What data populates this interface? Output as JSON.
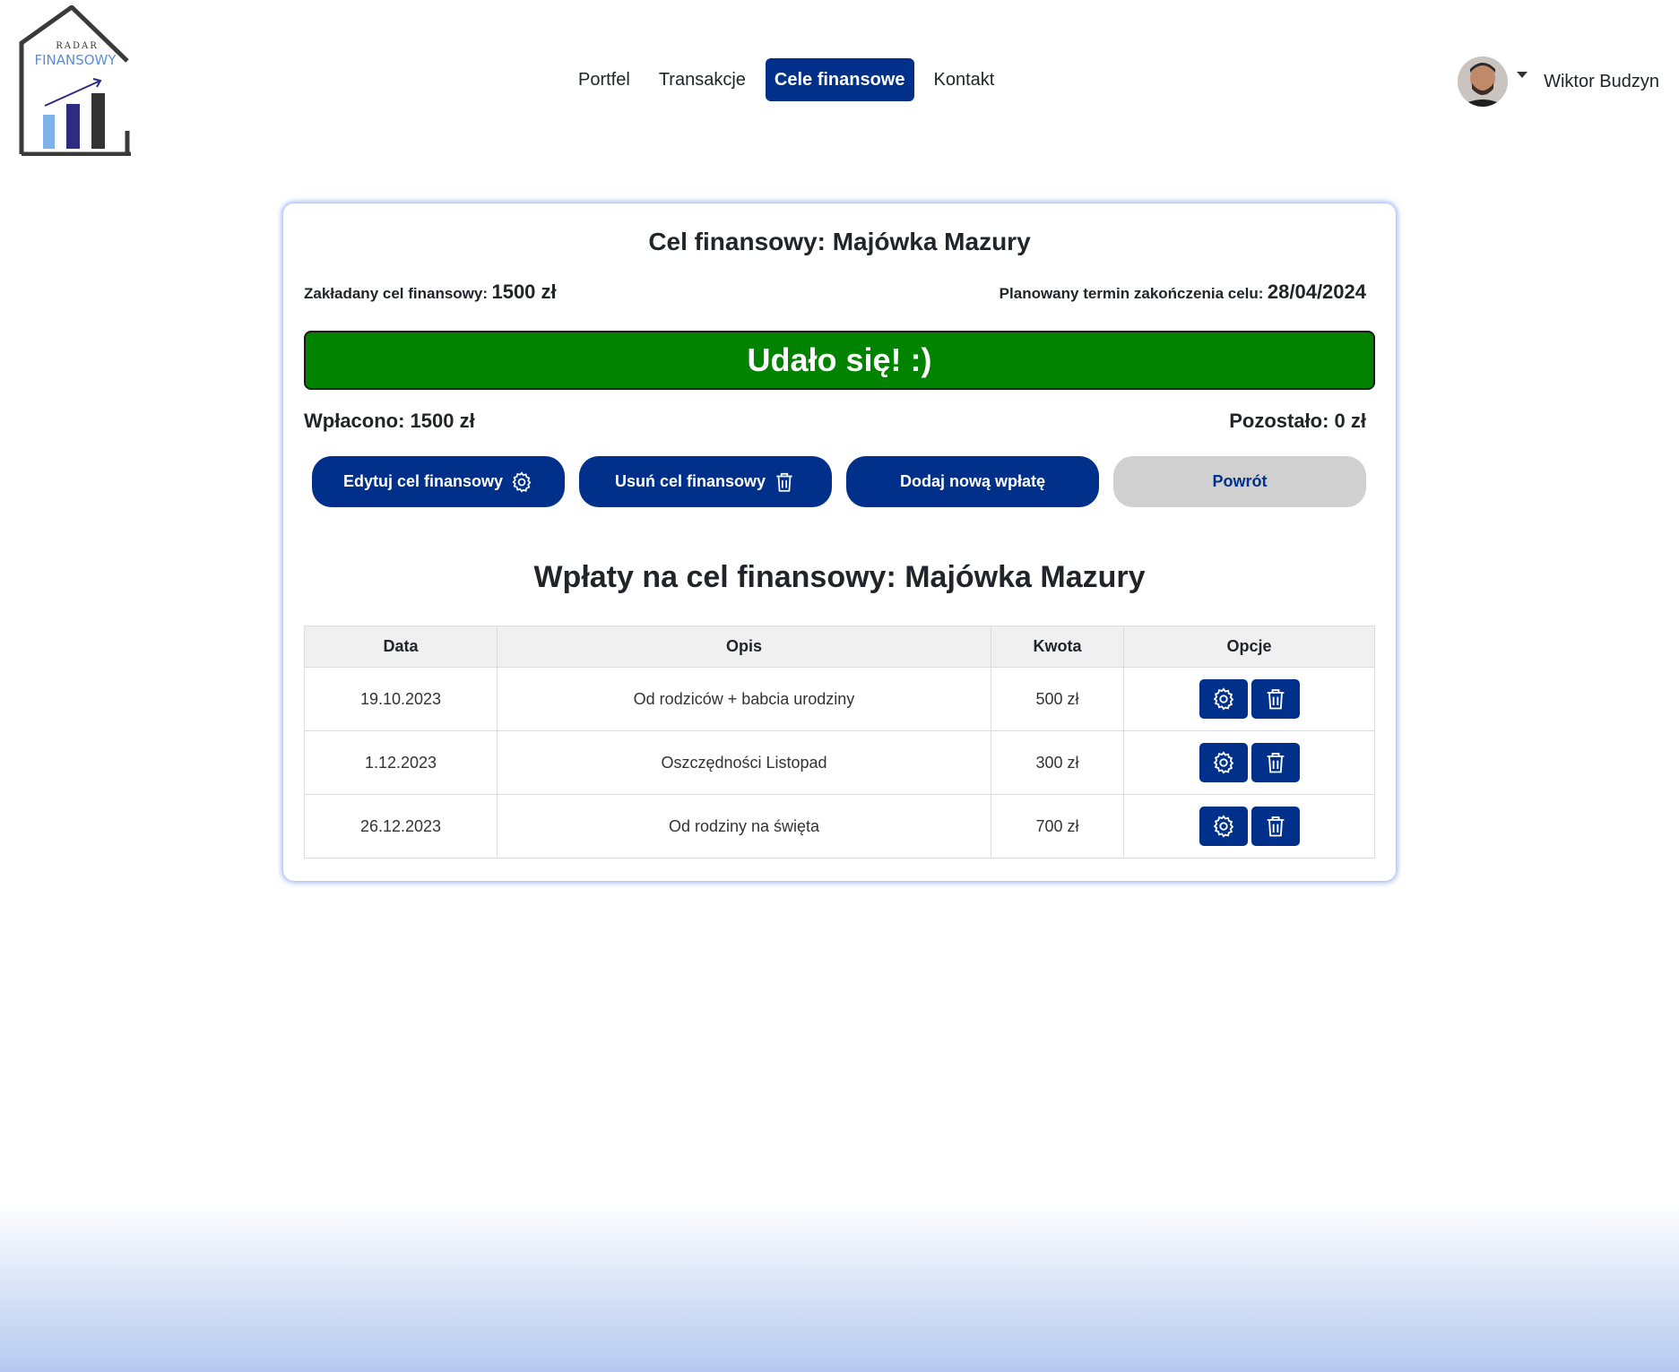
{
  "brand": {
    "logo_top": "RADAR",
    "logo_bottom": "FINANSOWY"
  },
  "nav": {
    "items": [
      {
        "label": "Portfel"
      },
      {
        "label": "Transakcje"
      },
      {
        "label": "Cele finansowe"
      },
      {
        "label": "Kontakt"
      }
    ],
    "active": "Cele finansowe"
  },
  "user": {
    "name": "Wiktor Budzyn"
  },
  "goal": {
    "title": "Cel finansowy: Majówka Mazury",
    "target_label": "Zakładany cel finansowy:",
    "target_value": "1500 zł",
    "deadline_label": "Planowany termin zakończenia celu:",
    "deadline_value": "28/04/2024",
    "status_text": "Udało się! :)",
    "status_color": "#028300",
    "paid_text": "Wpłacono: 1500 zł",
    "remaining_text": "Pozostało: 0 zł"
  },
  "actions": {
    "edit_label": "Edytuj cel finansowy",
    "delete_label": "Usuń cel finansowy",
    "add_label": "Dodaj nową wpłatę",
    "back_label": "Powrót"
  },
  "payments": {
    "title": "Wpłaty na cel finansowy: Majówka Mazury",
    "headers": {
      "date": "Data",
      "desc": "Opis",
      "amount": "Kwota",
      "options": "Opcje"
    },
    "rows": [
      {
        "date": "19.10.2023",
        "desc": "Od rodziców + babcia urodziny",
        "amount": "500 zł"
      },
      {
        "date": "1.12.2023",
        "desc": "Oszczędności Listopad",
        "amount": "300 zł"
      },
      {
        "date": "26.12.2023",
        "desc": "Od rodziny na święta",
        "amount": "700 zł"
      }
    ]
  },
  "colors": {
    "primary": "#00308a",
    "success": "#028300",
    "secondary": "#d0d0d0"
  },
  "icons": [
    "gear-icon",
    "trash-icon",
    "chevron-down-icon",
    "house-chart-logo"
  ]
}
